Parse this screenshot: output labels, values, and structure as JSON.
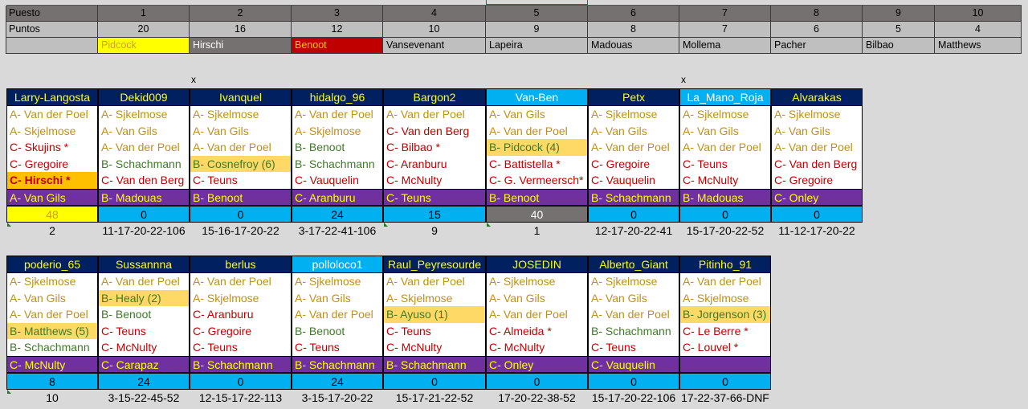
{
  "colors": {
    "A": "#c09018",
    "B": "#3e7a28",
    "C": "#c00000",
    "highlight": "#ffd966",
    "highlight_strong": "#ffc000",
    "header_navy": "#002060",
    "header_cyan": "#00b0f0",
    "score_cyan": "#00b0f0",
    "score_yellow": "#ffff00",
    "score_gray": "#767171",
    "bonus_purple": "#7030a0"
  },
  "ranking": {
    "puesto_label": "Puesto",
    "puntos_label": "Puntos",
    "positions": [
      "1",
      "2",
      "3",
      "4",
      "5",
      "6",
      "7",
      "8",
      "9",
      "10"
    ],
    "points": [
      "20",
      "16",
      "12",
      "10",
      "9",
      "8",
      "7",
      "6",
      "5",
      "4"
    ],
    "riders": [
      {
        "name": "Pidcock",
        "bg": "#ffff00",
        "color": "#c9a227"
      },
      {
        "name": "Hirschi",
        "bg": "#767171",
        "color": "#ffffff"
      },
      {
        "name": "Benoot",
        "bg": "#c00000",
        "color": "#ffc000"
      },
      {
        "name": "Vansevenant",
        "bg": "#bfbfbf",
        "color": "#000000"
      },
      {
        "name": "Lapeira",
        "bg": "#bfbfbf",
        "color": "#000000"
      },
      {
        "name": "Madouas",
        "bg": "#bfbfbf",
        "color": "#000000"
      },
      {
        "name": "Mollema",
        "bg": "#bfbfbf",
        "color": "#000000"
      },
      {
        "name": "Pacher",
        "bg": "#bfbfbf",
        "color": "#000000"
      },
      {
        "name": "Bilbao",
        "bg": "#bfbfbf",
        "color": "#000000"
      },
      {
        "name": "Matthews",
        "bg": "#bfbfbf",
        "color": "#000000"
      }
    ]
  },
  "marks": [
    "x",
    "x"
  ],
  "grid1": [
    {
      "name": "Larry-Langosta",
      "header": "navy",
      "picks": [
        {
          "t": "A- Van der Poel",
          "c": "A"
        },
        {
          "t": "A- Skjelmose",
          "c": "A"
        },
        {
          "t": "C- Skujins *",
          "c": "C"
        },
        {
          "t": "C- Gregoire",
          "c": "C"
        },
        {
          "t": "C- Hirschi *",
          "c": "C",
          "hl": "strong"
        }
      ],
      "bonus": "A- Van Gils",
      "score": "48",
      "score_style": "yellow",
      "foot": "2",
      "flag": true
    },
    {
      "name": "Dekid009",
      "header": "navy",
      "picks": [
        {
          "t": "A- Sjkelmose",
          "c": "A"
        },
        {
          "t": "A- Van Gils",
          "c": "A"
        },
        {
          "t": "A- Van der Poel",
          "c": "A"
        },
        {
          "t": "B- Schachmann",
          "c": "B"
        },
        {
          "t": "C- Van den Berg",
          "c": "C"
        }
      ],
      "bonus": "B- Madouas",
      "score": "0",
      "score_style": "cyan",
      "foot": "11-17-20-22-106"
    },
    {
      "name": "Ivanquel",
      "header": "navy",
      "picks": [
        {
          "t": "A- Sjkelmose",
          "c": "A"
        },
        {
          "t": "A- Van Gils",
          "c": "A"
        },
        {
          "t": "A- Van der Poel",
          "c": "A"
        },
        {
          "t": "B- Cosnefroy (6)",
          "c": "B",
          "hl": "soft"
        },
        {
          "t": "C- Teuns",
          "c": "C"
        }
      ],
      "bonus": "B- Benoot",
      "score": "0",
      "score_style": "cyan",
      "foot": "15-16-17-20-22"
    },
    {
      "name": "hidalgo_96",
      "header": "navy",
      "picks": [
        {
          "t": "A- Van der Poel",
          "c": "A"
        },
        {
          "t": "A- Skjelmose",
          "c": "A"
        },
        {
          "t": "B- Benoot",
          "c": "B"
        },
        {
          "t": "B- Schachmann",
          "c": "B"
        },
        {
          "t": "C- Vauquelin",
          "c": "C"
        }
      ],
      "bonus": "C- Aranburu",
      "score": "24",
      "score_style": "cyan",
      "foot": "3-17-22-41-106"
    },
    {
      "name": "Bargon2",
      "header": "navy",
      "picks": [
        {
          "t": "A- Van der Poel",
          "c": "A"
        },
        {
          "t": "C- Van den Berg",
          "c": "C"
        },
        {
          "t": "C- Bilbao *",
          "c": "C"
        },
        {
          "t": "C- Aranburu",
          "c": "C"
        },
        {
          "t": "C- McNulty",
          "c": "C"
        }
      ],
      "bonus": "C- Teuns",
      "score": "15",
      "score_style": "cyan",
      "foot": "9",
      "flag": true
    },
    {
      "name": "Van-Ben",
      "header": "cyan",
      "picks": [
        {
          "t": "A- Van Gils",
          "c": "A"
        },
        {
          "t": "A- Van der Poel",
          "c": "A"
        },
        {
          "t": "B- Pidcock (4)",
          "c": "B",
          "hl": "soft"
        },
        {
          "t": "C- Battistella *",
          "c": "C"
        },
        {
          "t": "C- G. Vermeersch*",
          "c": "C"
        }
      ],
      "bonus": "B- Benoot",
      "score": "40",
      "score_style": "gray",
      "foot": "1",
      "flag": true
    },
    {
      "name": "Petx",
      "header": "navy",
      "picks": [
        {
          "t": "A- Sjkelmose",
          "c": "A"
        },
        {
          "t": "A- Van Gils",
          "c": "A"
        },
        {
          "t": "A- Van der Poel",
          "c": "A"
        },
        {
          "t": "C- Gregoire",
          "c": "C"
        },
        {
          "t": "C- Vauquelin",
          "c": "C"
        }
      ],
      "bonus": "B- Schachmann",
      "score": "0",
      "score_style": "cyan",
      "foot": "12-17-20-22-41"
    },
    {
      "name": "La_Mano_Roja",
      "header": "cyan",
      "picks": [
        {
          "t": "A- Sjkelmose",
          "c": "A"
        },
        {
          "t": "A- Van Gils",
          "c": "A"
        },
        {
          "t": "A- Van der Poel",
          "c": "A"
        },
        {
          "t": "C- Teuns",
          "c": "C"
        },
        {
          "t": "C- McNulty",
          "c": "C"
        }
      ],
      "bonus": "B- Madouas",
      "score": "0",
      "score_style": "cyan",
      "foot": "15-17-20-22-52"
    },
    {
      "name": "Alvarakas",
      "header": "navy",
      "picks": [
        {
          "t": "A- Sjkelmose",
          "c": "A"
        },
        {
          "t": "A- Van Gils",
          "c": "A"
        },
        {
          "t": "A- Van der Poel",
          "c": "A"
        },
        {
          "t": "C- Van den Berg",
          "c": "C"
        },
        {
          "t": "C- Gregoire",
          "c": "C"
        }
      ],
      "bonus": "C- Onley",
      "score": "0",
      "score_style": "cyan",
      "foot": "11-12-17-20-22"
    }
  ],
  "grid2": [
    {
      "name": "poderio_65",
      "header": "navy",
      "picks": [
        {
          "t": "A- Sjkelmose",
          "c": "A"
        },
        {
          "t": "A- Van Gils",
          "c": "A"
        },
        {
          "t": "A- Van der Poel",
          "c": "A"
        },
        {
          "t": "B- Matthews (5)",
          "c": "B",
          "hl": "soft"
        },
        {
          "t": "B- Schachmann",
          "c": "B"
        }
      ],
      "bonus": "C- McNulty",
      "score": "8",
      "score_style": "cyan",
      "foot": "10",
      "flag": true
    },
    {
      "name": "Sussannna",
      "header": "navy",
      "picks": [
        {
          "t": "A- Van der Poel",
          "c": "A"
        },
        {
          "t": "B- Healy (2)",
          "c": "B",
          "hl": "soft"
        },
        {
          "t": "B- Benoot",
          "c": "B"
        },
        {
          "t": "C- Teuns",
          "c": "C"
        },
        {
          "t": "C- McNulty",
          "c": "C"
        }
      ],
      "bonus": "C- Carapaz",
      "score": "24",
      "score_style": "cyan",
      "foot": "3-15-22-45-52"
    },
    {
      "name": "berlus",
      "header": "navy",
      "picks": [
        {
          "t": "A- Van der Poel",
          "c": "A"
        },
        {
          "t": "A- Skjelmose",
          "c": "A"
        },
        {
          "t": "C- Aranburu",
          "c": "C"
        },
        {
          "t": "C- Gregoire",
          "c": "C"
        },
        {
          "t": "C- Teuns",
          "c": "C"
        }
      ],
      "bonus": "B- Schachmann",
      "score": "0",
      "score_style": "cyan",
      "foot": "12-15-17-22-113"
    },
    {
      "name": "polloloco1",
      "header": "cyan",
      "picks": [
        {
          "t": "A- Sjkelmose",
          "c": "A"
        },
        {
          "t": "A- Van Gils",
          "c": "A"
        },
        {
          "t": "A- Van der Poel",
          "c": "A"
        },
        {
          "t": "B- Benoot",
          "c": "B"
        },
        {
          "t": "C- Teuns",
          "c": "C"
        }
      ],
      "bonus": "B- Schachmann",
      "score": "24",
      "score_style": "cyan",
      "foot": "3-15-17-20-22"
    },
    {
      "name": "Raul_Peyresourde",
      "header": "navy",
      "picks": [
        {
          "t": "A- Van der Poel",
          "c": "A"
        },
        {
          "t": "A- Skjelmose",
          "c": "A"
        },
        {
          "t": "B- Ayuso (1)",
          "c": "B",
          "hl": "soft"
        },
        {
          "t": "C- Teuns",
          "c": "C"
        },
        {
          "t": "C- McNulty",
          "c": "C"
        }
      ],
      "bonus": "B- Schachmann",
      "score": "0",
      "score_style": "cyan",
      "foot": "15-17-21-22-52"
    },
    {
      "name": "JOSEDIN",
      "header": "navy",
      "picks": [
        {
          "t": "A- Sjkelmose",
          "c": "A"
        },
        {
          "t": "A- Van Gils",
          "c": "A"
        },
        {
          "t": "A- Van der Poel",
          "c": "A"
        },
        {
          "t": "C- Almeida *",
          "c": "C"
        },
        {
          "t": "C- McNulty",
          "c": "C"
        }
      ],
      "bonus": "C- Onley",
      "score": "0",
      "score_style": "cyan",
      "foot": "17-20-22-38-52"
    },
    {
      "name": "Alberto_Giant",
      "header": "navy",
      "picks": [
        {
          "t": "A- Sjkelmose",
          "c": "A"
        },
        {
          "t": "A- Van Gils",
          "c": "A"
        },
        {
          "t": "A- Van der Poel",
          "c": "A"
        },
        {
          "t": "B- Schachmann",
          "c": "B"
        },
        {
          "t": "C- Teuns",
          "c": "C"
        }
      ],
      "bonus": "C- Vauquelin",
      "score": "0",
      "score_style": "cyan",
      "foot": "15-17-20-22-106"
    },
    {
      "name": "Pitinho_91",
      "header": "navy",
      "picks": [
        {
          "t": "A- Van der Poel",
          "c": "A"
        },
        {
          "t": "A- Skjelmose",
          "c": "A"
        },
        {
          "t": "B- Jorgenson (3)",
          "c": "B",
          "hl": "soft"
        },
        {
          "t": "C- Le Berre *",
          "c": "C"
        },
        {
          "t": "C- Louvel *",
          "c": "C"
        }
      ],
      "bonus": "",
      "score": "0",
      "score_style": "cyan",
      "foot": "17-22-37-66-DNF"
    }
  ]
}
